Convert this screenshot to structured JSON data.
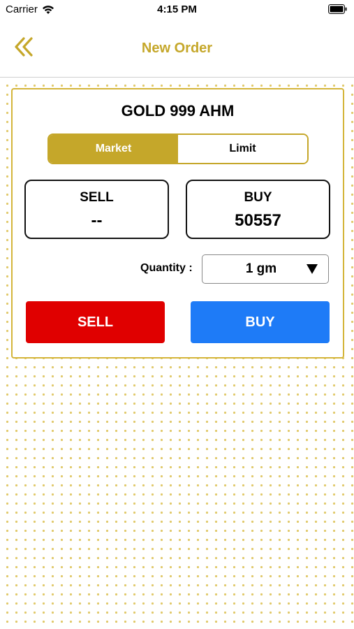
{
  "status_bar": {
    "carrier": "Carrier",
    "time": "4:15 PM"
  },
  "nav": {
    "title": "New Order",
    "back_icon": "double-chevron-left-icon"
  },
  "order": {
    "instrument": "GOLD 999 AHM",
    "order_types": [
      "Market",
      "Limit"
    ],
    "selected_order_type": "Market",
    "sell_label": "SELL",
    "sell_value": "--",
    "buy_label": "BUY",
    "buy_value": "50557",
    "quantity_label": "Quantity :",
    "quantity_value": "1 gm",
    "sell_button": "SELL",
    "buy_button": "BUY"
  },
  "colors": {
    "accent": "#c5a72a",
    "sell": "#e00000",
    "buy": "#1e7bf7"
  }
}
